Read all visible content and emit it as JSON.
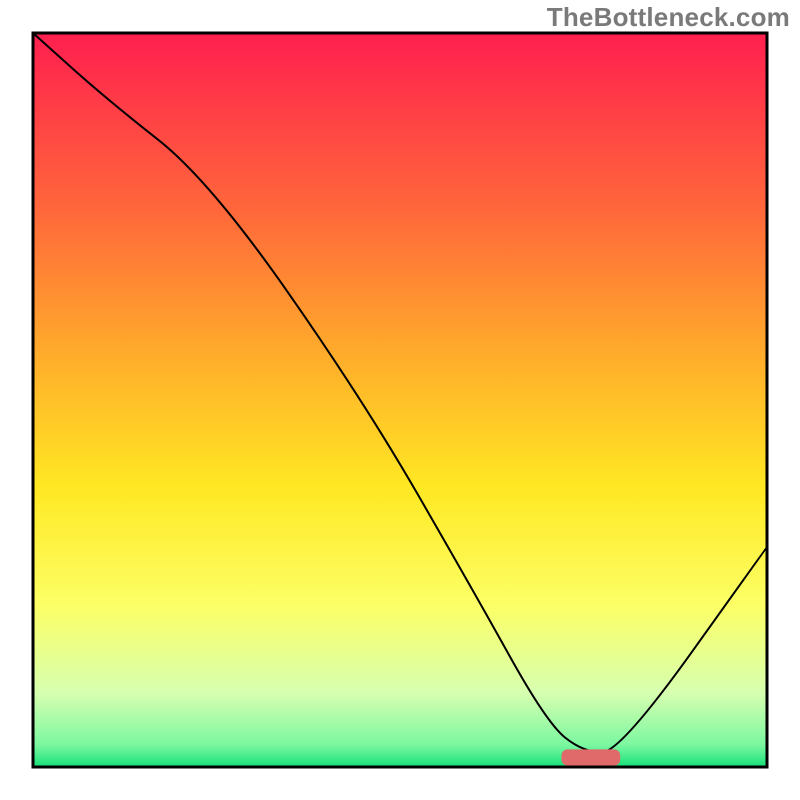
{
  "watermark": "TheBottleneck.com",
  "chart_data": {
    "type": "line",
    "title": "",
    "xlabel": "",
    "ylabel": "",
    "xlim": [
      0,
      100
    ],
    "ylim": [
      0,
      100
    ],
    "grid": false,
    "legend": false,
    "axes_visible": false,
    "background": {
      "type": "vertical-gradient",
      "stops": [
        {
          "pos": 0.0,
          "color": "#ff1f4f"
        },
        {
          "pos": 0.25,
          "color": "#ff6a3a"
        },
        {
          "pos": 0.45,
          "color": "#ffb02a"
        },
        {
          "pos": 0.62,
          "color": "#ffe823"
        },
        {
          "pos": 0.78,
          "color": "#fcff66"
        },
        {
          "pos": 0.9,
          "color": "#d6ffb0"
        },
        {
          "pos": 0.97,
          "color": "#7bf7a0"
        },
        {
          "pos": 1.0,
          "color": "#15e07a"
        }
      ]
    },
    "series": [
      {
        "name": "bottleneck-curve",
        "stroke": "#000000",
        "stroke_width": 2,
        "x": [
          0,
          10,
          24,
          45,
          60,
          70,
          75,
          80,
          100
        ],
        "y": [
          100,
          91,
          80,
          50,
          24,
          6,
          2,
          2,
          30
        ]
      }
    ],
    "markers": [
      {
        "name": "optimal-range-marker",
        "shape": "rounded-rect",
        "x_range": [
          72,
          80
        ],
        "y": 1.3,
        "height": 2.2,
        "color": "#e06a6a"
      }
    ],
    "notes": "No numeric axis ticks or labels are visible in the image; x and y values are read off the plot as percentages of the plot area."
  }
}
